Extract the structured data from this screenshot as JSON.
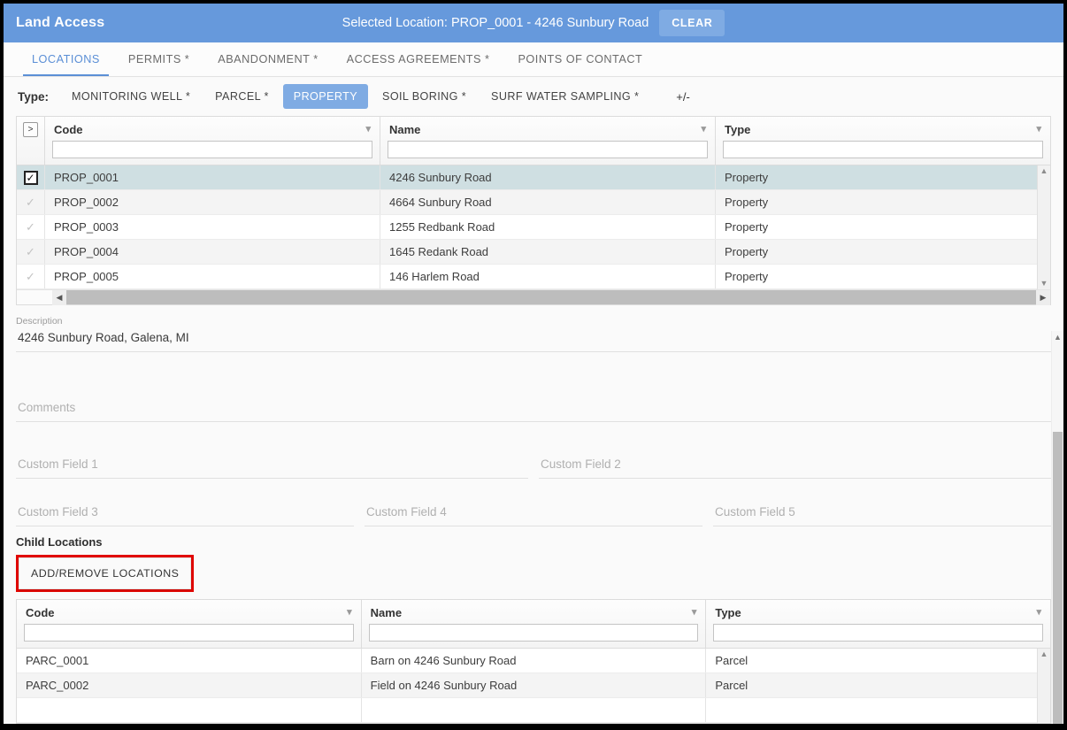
{
  "appbar": {
    "title": "Land Access",
    "selected_location": "Selected Location: PROP_0001 - 4246 Sunbury Road",
    "clear_label": "CLEAR",
    "bg_color": "#6699DC",
    "clear_bg_color": "#7fabe3"
  },
  "tabs": [
    {
      "label": "LOCATIONS",
      "active": true
    },
    {
      "label": "PERMITS *",
      "active": false
    },
    {
      "label": "ABANDONMENT *",
      "active": false
    },
    {
      "label": "ACCESS AGREEMENTS *",
      "active": false
    },
    {
      "label": "POINTS OF CONTACT",
      "active": false
    }
  ],
  "type_filter": {
    "label": "Type:",
    "chips": [
      {
        "label": "MONITORING WELL *",
        "active": false
      },
      {
        "label": "PARCEL *",
        "active": false
      },
      {
        "label": "PROPERTY",
        "active": true
      },
      {
        "label": "SOIL BORING *",
        "active": false
      },
      {
        "label": "SURF WATER SAMPLING *",
        "active": false
      }
    ],
    "toggle_label": "+/-"
  },
  "main_grid": {
    "expander_label": ">",
    "columns": [
      {
        "header": "Code",
        "filter_value": ""
      },
      {
        "header": "Name",
        "filter_value": ""
      },
      {
        "header": "Type",
        "filter_value": ""
      }
    ],
    "rows": [
      {
        "code": "PROP_0001",
        "name": "4246 Sunbury Road",
        "type": "Property",
        "selected": true
      },
      {
        "code": "PROP_0002",
        "name": "4664 Sunbury Road",
        "type": "Property",
        "selected": false
      },
      {
        "code": "PROP_0003",
        "name": "1255 Redbank Road",
        "type": "Property",
        "selected": false
      },
      {
        "code": "PROP_0004",
        "name": "1645 Redank Road",
        "type": "Property",
        "selected": false
      },
      {
        "code": "PROP_0005",
        "name": "146 Harlem Road",
        "type": "Property",
        "selected": false
      }
    ],
    "scroll_up": "▲",
    "scroll_down": "▼",
    "scroll_left": "◀",
    "scroll_right": "▶",
    "selected_row_color": "#cfdfe2"
  },
  "form": {
    "description": {
      "label": "Description",
      "value": "4246 Sunbury Road, Galena, MI"
    },
    "comments": {
      "label": "Comments",
      "value": "",
      "placeholder": "Comments"
    },
    "custom_field_1": {
      "placeholder": "Custom Field 1",
      "value": ""
    },
    "custom_field_2": {
      "placeholder": "Custom Field 2",
      "value": ""
    },
    "custom_field_3": {
      "placeholder": "Custom Field 3",
      "value": ""
    },
    "custom_field_4": {
      "placeholder": "Custom Field 4",
      "value": ""
    },
    "custom_field_5": {
      "placeholder": "Custom Field 5",
      "value": ""
    }
  },
  "child_section": {
    "title": "Child Locations",
    "add_remove_label": "ADD/REMOVE LOCATIONS",
    "highlight_color": "#e10600",
    "columns": [
      {
        "header": "Code",
        "filter_value": ""
      },
      {
        "header": "Name",
        "filter_value": ""
      },
      {
        "header": "Type",
        "filter_value": ""
      }
    ],
    "rows": [
      {
        "code": "PARC_0001",
        "name": "Barn on 4246 Sunbury Road",
        "type": "Parcel"
      },
      {
        "code": "PARC_0002",
        "name": "Field on 4246 Sunbury Road",
        "type": "Parcel"
      }
    ],
    "scroll_up": "▲"
  }
}
